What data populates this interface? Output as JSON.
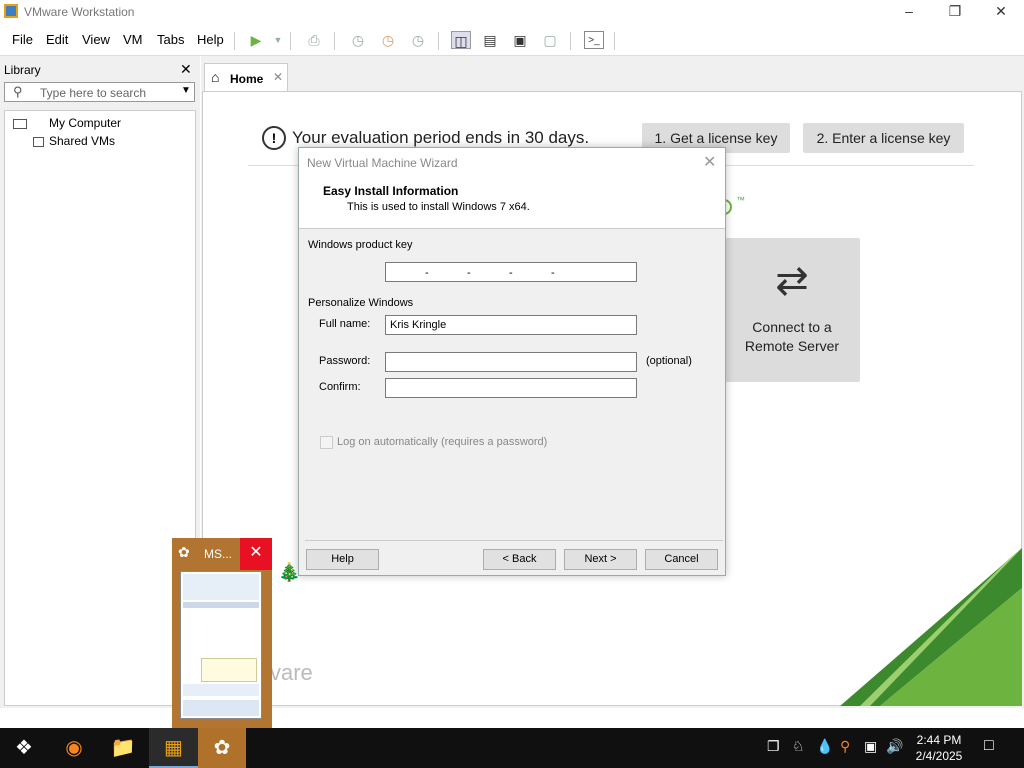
{
  "window": {
    "title": "VMware Workstation"
  },
  "menubar": {
    "items": [
      "File",
      "Edit",
      "View",
      "VM",
      "Tabs",
      "Help"
    ]
  },
  "library": {
    "title": "Library",
    "search_placeholder": "Type here to search",
    "tree": [
      "My Computer",
      "Shared VMs"
    ]
  },
  "tabs": [
    {
      "label": "Home"
    }
  ],
  "home": {
    "evaluation_text": "Your evaluation period ends in 30 days.",
    "get_license": "1. Get a license key",
    "enter_license": "2. Enter a license key",
    "connect_remote_line1": "Connect to a",
    "connect_remote_line2": "Remote Server",
    "trademark": "™",
    "brand_fragment": "vare"
  },
  "wizard": {
    "title": "New Virtual Machine Wizard",
    "heading": "Easy Install Information",
    "subheading": "This is used to install Windows 7 x64.",
    "product_key_label": "Windows product key",
    "personalize_label": "Personalize Windows",
    "fullname_label": "Full name:",
    "fullname_value": "Kris Kringle",
    "password_label": "Password:",
    "password_hint": "(optional)",
    "confirm_label": "Confirm:",
    "autologon_label": "Log on automatically (requires a password)",
    "buttons": {
      "help": "Help",
      "back": "< Back",
      "next": "Next >",
      "cancel": "Cancel"
    }
  },
  "messenger_popup": {
    "title": "MS..."
  },
  "taskbar": {
    "time": "2:44 PM",
    "date": "2/4/2025"
  },
  "colors": {
    "accent_green": "#6db33f",
    "close_red": "#e81123",
    "taskbar_bg": "#101010"
  }
}
